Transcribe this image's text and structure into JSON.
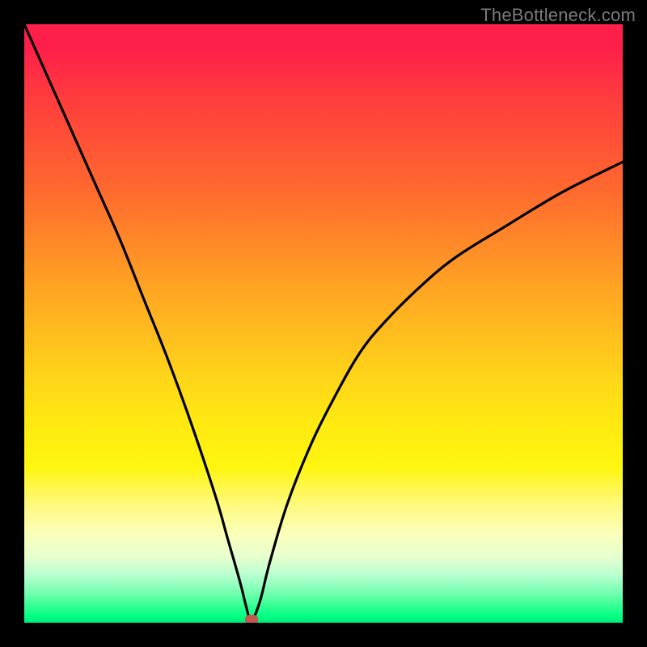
{
  "watermark": "TheBottleneck.com",
  "chart_data": {
    "type": "line",
    "title": "",
    "xlabel": "",
    "ylabel": "",
    "xlim": [
      0,
      100
    ],
    "ylim": [
      0,
      100
    ],
    "grid": false,
    "legend": false,
    "background_gradient": {
      "direction": "vertical",
      "stops": [
        {
          "pos": 0,
          "color": "#ff1f4a"
        },
        {
          "pos": 50,
          "color": "#ffd21a"
        },
        {
          "pos": 85,
          "color": "#fbffb9"
        },
        {
          "pos": 100,
          "color": "#00e876"
        }
      ]
    },
    "series": [
      {
        "name": "bottleneck-curve",
        "color": "#000000",
        "x": [
          0,
          4,
          8,
          12,
          16,
          20,
          24,
          28,
          32,
          34,
          36,
          37,
          37.7,
          38.2,
          39.5,
          41,
          44,
          48,
          52,
          56,
          60,
          66,
          72,
          80,
          90,
          100
        ],
        "y": [
          100,
          91,
          82,
          73,
          64,
          54,
          44,
          33,
          21,
          14,
          7,
          3,
          0.5,
          0.5,
          4,
          10,
          20,
          30,
          38,
          45,
          50,
          56,
          61,
          66,
          72,
          77
        ]
      }
    ],
    "marker": {
      "name": "optimal-point",
      "x": 38,
      "y": 0.5,
      "color": "#c0594e"
    }
  }
}
